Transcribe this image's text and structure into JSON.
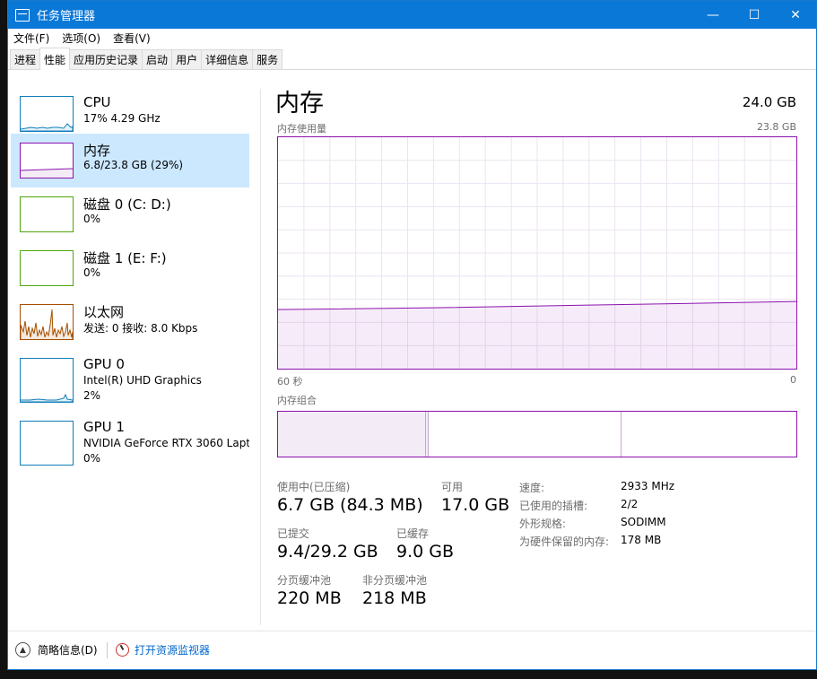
{
  "window": {
    "title": "任务管理器",
    "controls": {
      "minimize": "—",
      "maximize": "☐",
      "close": "✕"
    }
  },
  "menu": [
    "文件(F)",
    "选项(O)",
    "查看(V)"
  ],
  "tabs": [
    {
      "label": "进程",
      "active": false
    },
    {
      "label": "性能",
      "active": true
    },
    {
      "label": "应用历史记录",
      "active": false
    },
    {
      "label": "启动",
      "active": false
    },
    {
      "label": "用户",
      "active": false
    },
    {
      "label": "详细信息",
      "active": false
    },
    {
      "label": "服务",
      "active": false
    }
  ],
  "sidebar": {
    "items": [
      {
        "title": "CPU",
        "line1": "17% 4.29 GHz",
        "line2": ""
      },
      {
        "title": "内存",
        "line1": "6.8/23.8 GB (29%)",
        "line2": ""
      },
      {
        "title": "磁盘 0 (C: D:)",
        "line1": "0%",
        "line2": ""
      },
      {
        "title": "磁盘 1 (E: F:)",
        "line1": "0%",
        "line2": ""
      },
      {
        "title": "以太网",
        "line1": "发送: 0 接收: 8.0 Kbps",
        "line2": ""
      },
      {
        "title": "GPU 0",
        "line1": "Intel(R) UHD Graphics",
        "line2": "2%"
      },
      {
        "title": "GPU 1",
        "line1": "NVIDIA GeForce RTX 3060 Laptop",
        "line2": "0%"
      }
    ]
  },
  "main": {
    "title": "内存",
    "total": "24.0 GB",
    "usage_label": "内存使用量",
    "usage_max": "23.8 GB",
    "time_left": "60 秒",
    "time_right": "0",
    "composition_label": "内存组合",
    "usage_fraction": 0.29,
    "stats": {
      "in_use_label": "使用中(已压缩)",
      "in_use_value": "6.7 GB (84.3 MB)",
      "available_label": "可用",
      "available_value": "17.0 GB",
      "committed_label": "已提交",
      "committed_value": "9.4/29.2 GB",
      "cached_label": "已缓存",
      "cached_value": "9.0 GB",
      "paged_label": "分页缓冲池",
      "paged_value": "220 MB",
      "nonpaged_label": "非分页缓冲池",
      "nonpaged_value": "218 MB"
    },
    "details": [
      {
        "label": "速度:",
        "value": "2933 MHz"
      },
      {
        "label": "已使用的插槽:",
        "value": "2/2"
      },
      {
        "label": "外形规格:",
        "value": "SODIMM"
      },
      {
        "label": "为硬件保留的内存:",
        "value": "178 MB"
      }
    ]
  },
  "footer": {
    "fewer_details": "简略信息(D)",
    "open_resmon": "打开资源监视器"
  },
  "colors": {
    "memory": "#8b12ae",
    "cpu": "#117dbb",
    "disk": "#4da60c",
    "ethernet": "#a74f01",
    "gpu": "#117dbb",
    "selected": "#cce8ff",
    "titlebar": "#0a78d7"
  }
}
